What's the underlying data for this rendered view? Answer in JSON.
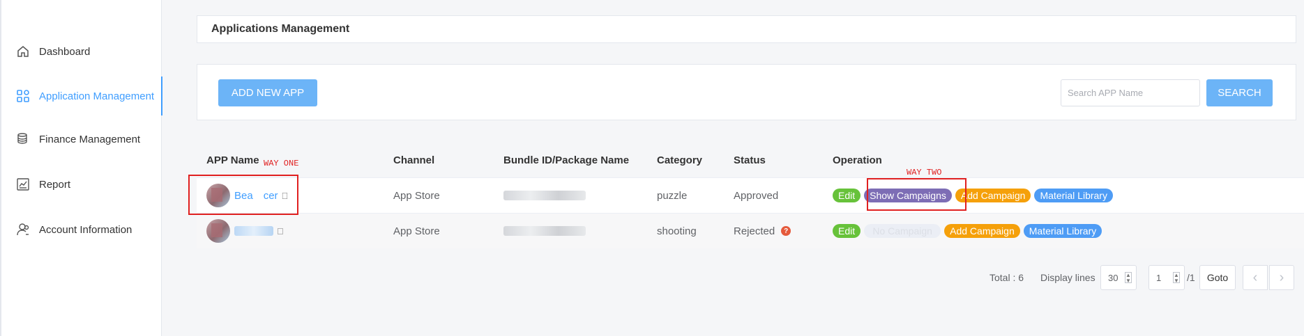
{
  "sidebar": {
    "items": [
      {
        "label": "Dashboard",
        "icon": "home-icon"
      },
      {
        "label": "Application Management",
        "icon": "grid-icon",
        "active": true
      },
      {
        "label": "Finance Management",
        "icon": "coins-icon"
      },
      {
        "label": "Report",
        "icon": "chart-icon"
      },
      {
        "label": "Account Information",
        "icon": "users-icon"
      }
    ]
  },
  "page_title": "Applications Management",
  "toolbar": {
    "add_label": "ADD NEW APP",
    "search_placeholder": "Search APP Name",
    "search_label": "SEARCH"
  },
  "table": {
    "headers": [
      "APP Name",
      "Channel",
      "Bundle ID/Package Name",
      "Category",
      "Status",
      "Operation"
    ],
    "rows": [
      {
        "name": "Bea cer",
        "channel": "App Store",
        "category": "puzzle",
        "status": "Approved",
        "ops": [
          "Edit",
          "Show Campaigns",
          "Add Campaign",
          "Material Library"
        ]
      },
      {
        "name": "",
        "channel": "App Store",
        "category": "shooting",
        "status": "Rejected",
        "ops": [
          "Edit",
          "No Campaign",
          "Add Campaign",
          "Material Library"
        ]
      }
    ]
  },
  "annotations": {
    "way_one": "WAY ONE",
    "way_two": "WAY TWO"
  },
  "pagination": {
    "total_label": "Total : 6",
    "display_lines_label": "Display lines",
    "display_lines_value": "30",
    "page_value": "1",
    "page_total": "/1",
    "goto_label": "Goto"
  },
  "colors": {
    "accent": "#409eff",
    "edit": "#67c23a",
    "show": "#7d6db5",
    "add": "#f5a00a",
    "library": "#4e9cf5",
    "annotation": "#e02020"
  }
}
